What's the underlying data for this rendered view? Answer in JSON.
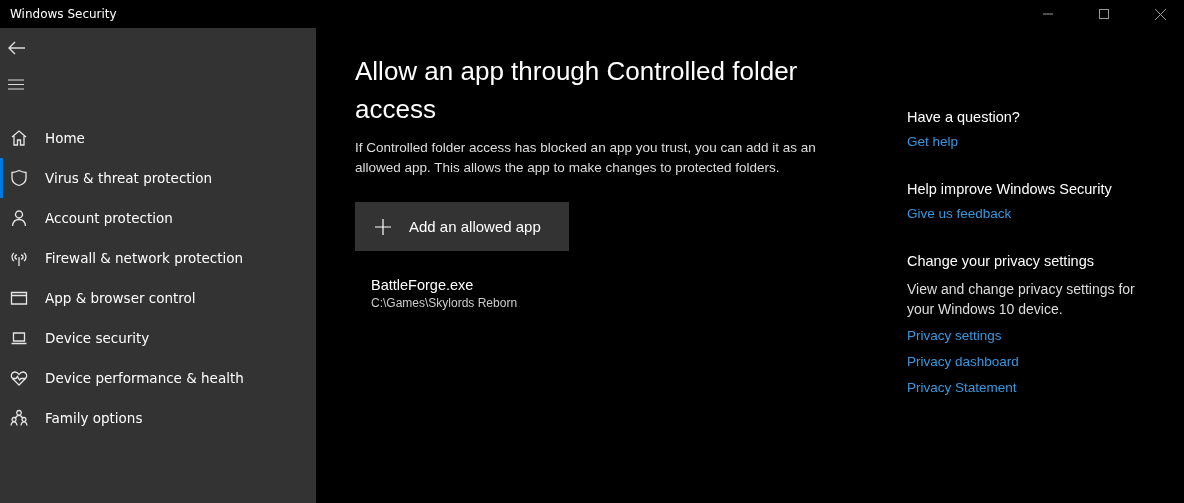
{
  "window": {
    "title": "Windows Security"
  },
  "sidebar": {
    "items": [
      {
        "label": "Home",
        "kind": "home",
        "selected": false
      },
      {
        "label": "Virus & threat protection",
        "kind": "shield",
        "selected": true
      },
      {
        "label": "Account protection",
        "kind": "person",
        "selected": false
      },
      {
        "label": "Firewall & network protection",
        "kind": "antenna",
        "selected": false
      },
      {
        "label": "App & browser control",
        "kind": "window",
        "selected": false
      },
      {
        "label": "Device security",
        "kind": "laptop",
        "selected": false
      },
      {
        "label": "Device performance & health",
        "kind": "heart",
        "selected": false
      },
      {
        "label": "Family options",
        "kind": "family",
        "selected": false
      }
    ]
  },
  "main": {
    "title": "Allow an app through Controlled folder access",
    "description": "If Controlled folder access has blocked an app you trust, you can add it as an allowed app. This allows the app to make changes to protected folders.",
    "add_button": "Add an allowed app",
    "apps": [
      {
        "name": "BattleForge.exe",
        "path": "C:\\Games\\Skylords Reborn"
      }
    ]
  },
  "aside": [
    {
      "heading": "Have a question?",
      "links": [
        "Get help"
      ]
    },
    {
      "heading": "Help improve Windows Security",
      "links": [
        "Give us feedback"
      ]
    },
    {
      "heading": "Change your privacy settings",
      "text": "View and change privacy settings for your Windows 10 device.",
      "links": [
        "Privacy settings",
        "Privacy dashboard",
        "Privacy Statement"
      ]
    }
  ]
}
